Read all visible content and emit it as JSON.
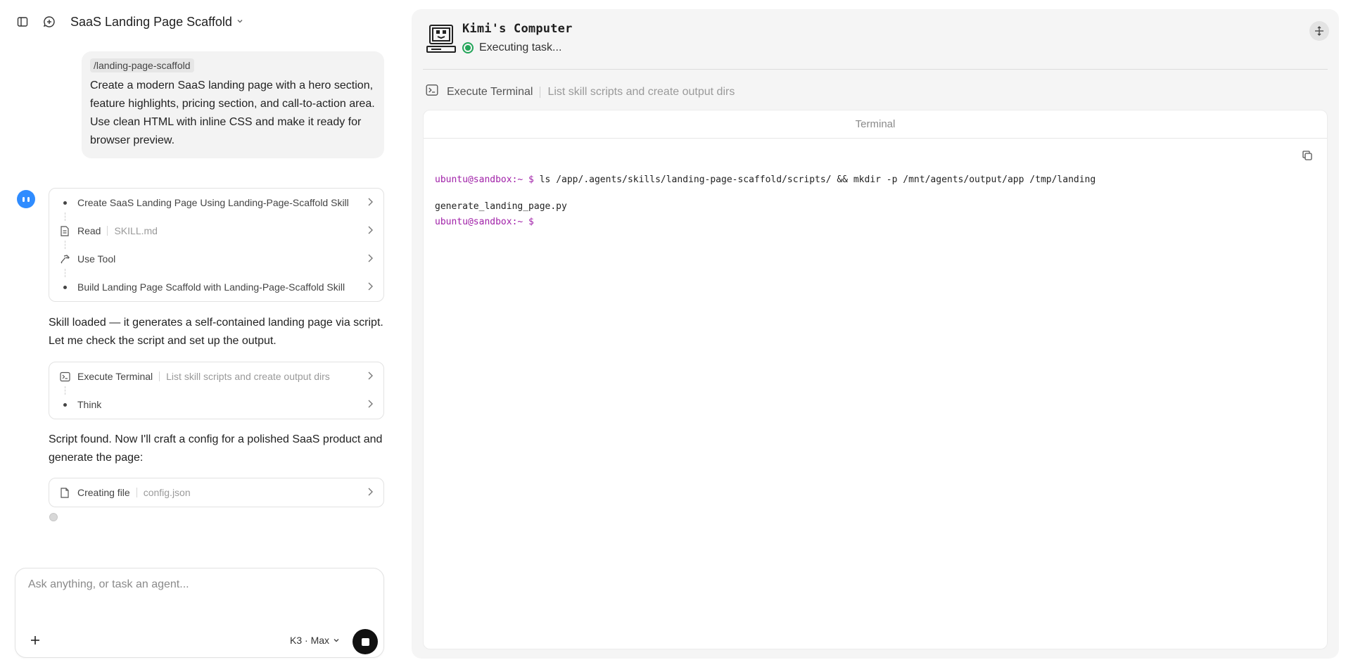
{
  "header": {
    "title": "SaaS Landing Page Scaffold"
  },
  "user_message": {
    "command": "/landing-page-scaffold",
    "text": "Create a modern SaaS landing page with a hero section, feature highlights, pricing section, and call-to-action area. Use clean HTML with inline CSS and make it ready for browser preview."
  },
  "steps_group_1": [
    {
      "icon": "bullet",
      "label": "Create SaaS Landing Page Using Landing-Page-Scaffold Skill",
      "sub": ""
    },
    {
      "icon": "file-icon",
      "label": "Read",
      "sub": "SKILL.md"
    },
    {
      "icon": "hammer-icon",
      "label": "Use Tool",
      "sub": ""
    },
    {
      "icon": "bullet",
      "label": "Build Landing Page Scaffold with Landing-Page-Scaffold Skill",
      "sub": ""
    }
  ],
  "assistant_text_1": "Skill loaded — it generates a self-contained landing page via script. Let me check the script and set up the output.",
  "steps_group_2": [
    {
      "icon": "terminal-icon",
      "label": "Execute Terminal",
      "sub": "List skill scripts and create output dirs"
    },
    {
      "icon": "bullet",
      "label": "Think",
      "sub": ""
    }
  ],
  "assistant_text_2": "Script found. Now I'll craft a config for a polished SaaS product and generate the page:",
  "steps_group_3": [
    {
      "icon": "file-icon",
      "label": "Creating file",
      "sub": "config.json"
    }
  ],
  "composer": {
    "placeholder": "Ask anything, or task an agent...",
    "model": "K3 · Max"
  },
  "computer": {
    "title": "Kimi's Computer",
    "status": "Executing task...",
    "tool_label": "Execute Terminal",
    "tool_sub": "List skill scripts and create output dirs",
    "terminal_title": "Terminal",
    "prompt": "ubuntu@sandbox:~ $",
    "command": " ls /app/.agents/skills/landing-page-scaffold/scripts/ && mkdir -p /mnt/agents/output/app /tmp/landing",
    "output": "generate_landing_page.py",
    "prompt2": "ubuntu@sandbox:~ $"
  },
  "colors": {
    "accent_blue": "#2f8cff",
    "status_green": "#23a559",
    "prompt_purple": "#a020a8"
  }
}
